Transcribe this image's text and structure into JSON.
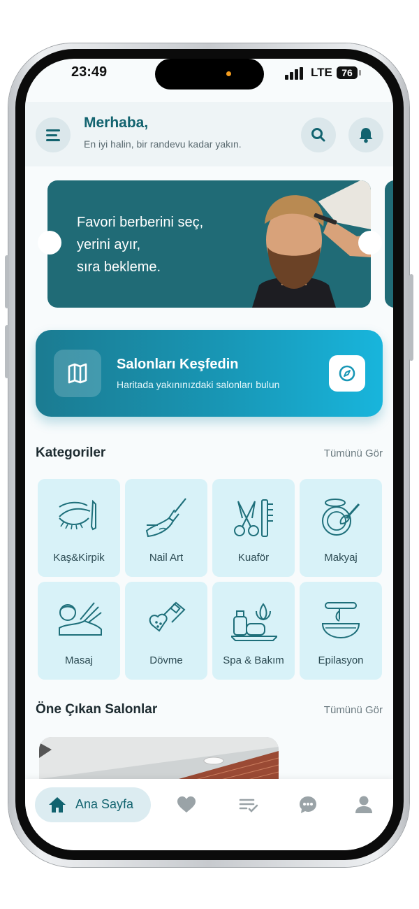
{
  "status_bar": {
    "time": "23:49",
    "network": "LTE",
    "battery": "76"
  },
  "header": {
    "greeting": "Merhaba,",
    "subtitle": "En iyi halin, bir randevu kadar yakın."
  },
  "banner": {
    "lines": [
      "Favori berberini seç,",
      "yerini ayır,",
      "sıra bekleme."
    ]
  },
  "explore": {
    "title": "Salonları Keşfedin",
    "subtitle": "Haritada yakınınızdaki salonları bulun"
  },
  "categories": {
    "title": "Kategoriler",
    "see_all": "Tümünü Gör",
    "items": [
      {
        "label": "Kaş&Kirpik",
        "icon": "eyelash-icon"
      },
      {
        "label": "Nail Art",
        "icon": "nail-polish-icon"
      },
      {
        "label": "Kuaför",
        "icon": "scissors-comb-icon"
      },
      {
        "label": "Makyaj",
        "icon": "compact-brush-icon"
      },
      {
        "label": "Masaj",
        "icon": "massage-icon"
      },
      {
        "label": "Dövme",
        "icon": "tattoo-machine-icon"
      },
      {
        "label": "Spa & Bakım",
        "icon": "spa-icon"
      },
      {
        "label": "Epilasyon",
        "icon": "wax-bowl-icon"
      }
    ]
  },
  "featured": {
    "title": "Öne Çıkan Salonlar",
    "see_all": "Tümünü Gör"
  },
  "tabbar": {
    "active_label": "Ana Sayfa",
    "items": [
      "home-icon",
      "heart-icon",
      "list-check-icon",
      "chat-icon",
      "user-icon"
    ]
  },
  "colors": {
    "primary": "#12636f",
    "accent": "#18b5dc",
    "tile_bg": "#d8f2f8"
  }
}
